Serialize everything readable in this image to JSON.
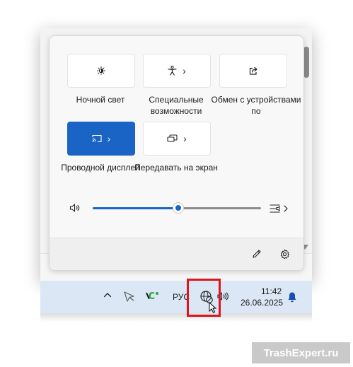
{
  "quick_settings": {
    "tiles": [
      {
        "label": "Ночной свет",
        "icon": "brightness-icon",
        "has_chevron": false,
        "active": false
      },
      {
        "label": "Специальные возможности",
        "icon": "accessibility-icon",
        "has_chevron": true,
        "active": false
      },
      {
        "label": "Обмен с устройствами по",
        "icon": "share-icon",
        "has_chevron": false,
        "active": false
      },
      {
        "label": "Проводной дисплей",
        "icon": "cast-icon",
        "has_chevron": true,
        "active": true
      },
      {
        "label": "Передавать на экран",
        "icon": "project-icon",
        "has_chevron": true,
        "active": false
      }
    ],
    "chevron": "›",
    "volume": {
      "level": 0.51
    },
    "footer": {
      "edit_icon": "pencil-icon",
      "settings_icon": "gear-icon"
    }
  },
  "taskbar": {
    "language": "РУС",
    "time": "11:42",
    "date": "26.06.2025"
  },
  "colors": {
    "accent": "#1a64c6",
    "highlight": "#e0141e",
    "taskbar": "#dbe7f5"
  },
  "watermark": "TrashExpert.ru"
}
